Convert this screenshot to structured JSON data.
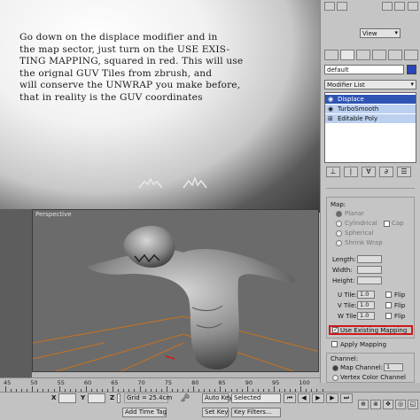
{
  "caption_lines": [
    "Go down on the displace modifier and in",
    "the map sector, just turn on the USE EXIS-",
    "TING MAPPING, squared in red. This will use",
    "the orignal GUV Tiles from zbrush, and",
    "will conserve the UNWRAP you make before,",
    "that in reality is the GUV coordinates"
  ],
  "viewport": {
    "label": "Perspective"
  },
  "panel": {
    "view_dropdown": "View",
    "object_name": "default",
    "object_color": "#2a46b8",
    "modifier_list_label": "Modifier List",
    "stack": [
      {
        "label": "Displace",
        "selected": true
      },
      {
        "label": "TurboSmooth",
        "selected": false
      },
      {
        "label": "Editable Poly",
        "selected": false
      }
    ],
    "map_group": "Map:",
    "map_types": [
      "Planar",
      "Cylindrical",
      "Cap",
      "Spherical",
      "Shrink Wrap"
    ],
    "length_label": "Length:",
    "width_label": "Width:",
    "height_label": "Height:",
    "utile_label": "U Tile:",
    "utile_value": "1.0",
    "vtile_label": "V Tile:",
    "vtile_value": "1.0",
    "wtile_label": "W Tile:",
    "wtile_value": "1.0",
    "flip_label": "Flip",
    "use_existing_label": "Use Existing Mapping",
    "use_existing_checked": true,
    "highlight_color": "#d21818",
    "apply_mapping_label": "Apply Mapping",
    "channel_group": "Channel:",
    "map_channel_label": "Map Channel:",
    "map_channel_value": "1",
    "vertex_color_label": "Vertex Color Channel"
  },
  "timeline": {
    "ticks": [
      "45",
      "50",
      "55",
      "60",
      "65",
      "70",
      "75",
      "80",
      "85",
      "90",
      "95",
      "100"
    ]
  },
  "statusbar": {
    "x_label": "X",
    "y_label": "Y",
    "z_label": "Z",
    "grid": "Grid = 25.4cm",
    "auto_key": "Auto Key",
    "selected": "Selected",
    "set_key": "Set Key",
    "key_filters": "Key Filters...",
    "add_time_tag": "Add Time Tag"
  }
}
